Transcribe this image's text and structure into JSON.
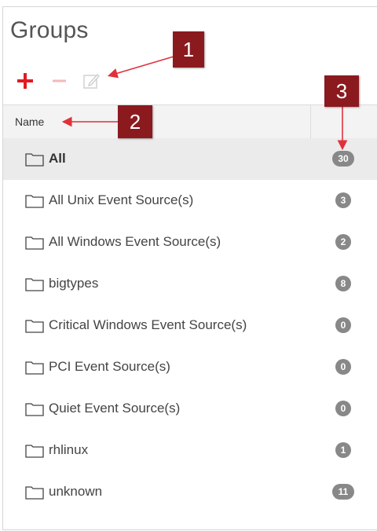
{
  "title": "Groups",
  "toolbar": {
    "add_icon": "plus-icon",
    "remove_icon": "minus-icon",
    "edit_icon": "edit-icon"
  },
  "table": {
    "column_name": "Name",
    "rows": [
      {
        "label": "All",
        "count": "30",
        "selected": true
      },
      {
        "label": "All Unix Event Source(s)",
        "count": "3"
      },
      {
        "label": "All Windows Event Source(s)",
        "count": "2"
      },
      {
        "label": "bigtypes",
        "count": "8"
      },
      {
        "label": "Critical Windows Event Source(s)",
        "count": "0"
      },
      {
        "label": "PCI Event Source(s)",
        "count": "0"
      },
      {
        "label": "Quiet Event Source(s)",
        "count": "0"
      },
      {
        "label": "rhlinux",
        "count": "1"
      },
      {
        "label": "unknown",
        "count": "11"
      }
    ]
  },
  "callouts": [
    "1",
    "2",
    "3"
  ],
  "colors": {
    "accent_red": "#e01b24",
    "callout_bg": "#8b1a1f",
    "badge_bg": "#888888",
    "selected_row": "#ebebeb",
    "header_bg": "#f3f3f3"
  }
}
